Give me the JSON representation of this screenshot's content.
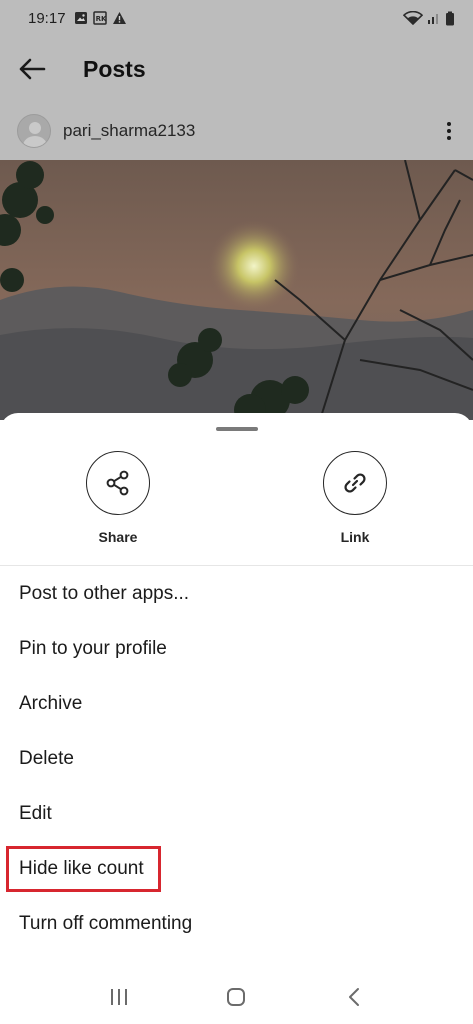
{
  "status_bar": {
    "time": "19:17",
    "left_icons": [
      "gallery-icon",
      "news-icon",
      "warning-icon"
    ],
    "right_icons": [
      "wifi-icon",
      "signal-icon",
      "battery-icon"
    ]
  },
  "header": {
    "title": "Posts",
    "back_icon": "arrow-left-icon"
  },
  "post": {
    "username": "pari_sharma2133",
    "more_icon": "more-vertical-icon"
  },
  "sheet": {
    "actions": [
      {
        "label": "Share",
        "icon": "share-icon"
      },
      {
        "label": "Link",
        "icon": "link-icon"
      }
    ],
    "menu": [
      "Post to other apps...",
      "Pin to your profile",
      "Archive",
      "Delete",
      "Edit",
      "Hide like count",
      "Turn off commenting"
    ],
    "highlight_color": "#d7262f"
  },
  "nav_bar": {
    "icons": [
      "recent-apps-icon",
      "home-icon",
      "back-nav-icon"
    ]
  },
  "colors": {
    "dim_overlay": "#bcbcbc",
    "sheet_bg": "#ffffff",
    "text": "#1b1b1b"
  }
}
